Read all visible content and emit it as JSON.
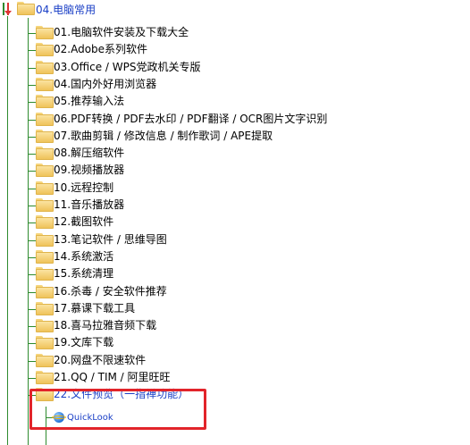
{
  "tree": {
    "root": {
      "label": "04.电脑常用"
    },
    "items": [
      {
        "label": "01.电脑软件安装及下载大全"
      },
      {
        "label": "02.Adobe系列软件"
      },
      {
        "label": "03.Office / WPS党政机关专版"
      },
      {
        "label": "04.国内外好用浏览器"
      },
      {
        "label": "05.推荐输入法"
      },
      {
        "label": "06.PDF转换 / PDF去水印 / PDF翻译 / OCR图片文字识别"
      },
      {
        "label": "07.歌曲剪辑 / 修改信息 / 制作歌词 / APE提取"
      },
      {
        "label": "08.解压缩软件"
      },
      {
        "label": "09.视频播放器"
      },
      {
        "label": "10.远程控制"
      },
      {
        "label": "11.音乐播放器"
      },
      {
        "label": "12.截图软件"
      },
      {
        "label": "13.笔记软件 / 思维导图"
      },
      {
        "label": "14.系统激活"
      },
      {
        "label": "15.系统清理"
      },
      {
        "label": "16.杀毒 / 安全软件推荐"
      },
      {
        "label": "17.慕课下载工具"
      },
      {
        "label": "18.喜马拉雅音频下载"
      },
      {
        "label": "19.文库下载"
      },
      {
        "label": "20.网盘不限速软件"
      },
      {
        "label": "21.QQ / TIM / 阿里旺旺"
      },
      {
        "label": "22.文件预览（一指禅功能）"
      }
    ],
    "child": {
      "label": "QuickLook"
    }
  },
  "colors": {
    "link": "#1a3fc6",
    "line": "#2e8b2e",
    "highlight": "#e2242a",
    "folder": "#f6d57b"
  }
}
